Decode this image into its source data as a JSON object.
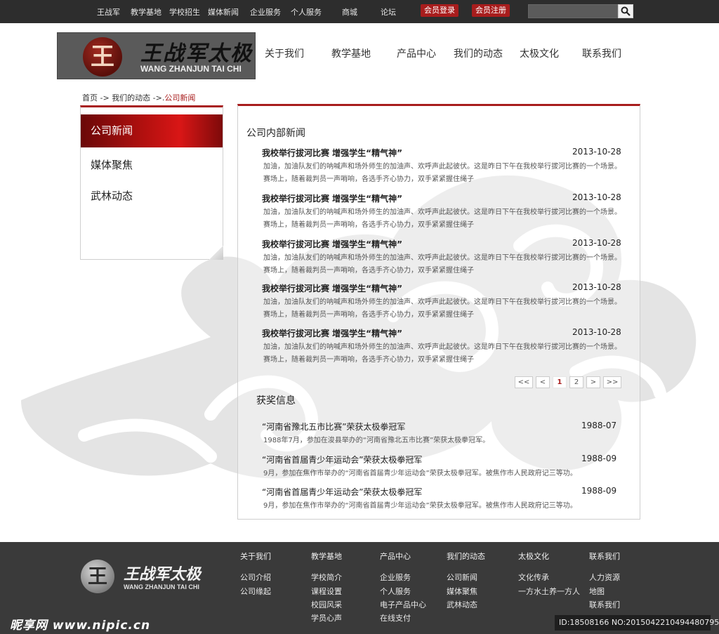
{
  "topbar": {
    "links": [
      "王战军",
      "教学基地",
      "学校招生",
      "媒体新闻",
      "企业服务",
      "个人服务",
      "商城",
      "论坛"
    ],
    "login_label": "会员登录",
    "register_label": "会员注册",
    "search_placeholder": ""
  },
  "header": {
    "logo_seal": "王",
    "logo_cn": "王战军太极",
    "logo_en": "WANG ZHANJUN TAI CHI",
    "nav": [
      "关于我们",
      "教学基地",
      "产品中心",
      "我们的动态",
      "太极文化",
      "联系我们"
    ]
  },
  "breadcrumb": {
    "home": "首页",
    "sep1": " -> ",
    "middle": "我们的动态",
    "sep2": " ->.",
    "current": "公司新闻"
  },
  "sidebar": {
    "items": [
      "公司新闻",
      "媒体聚焦",
      "武林动态"
    ]
  },
  "news": {
    "section_title": "公司内部新闻",
    "items": [
      {
        "title": "我校举行拔河比赛 增强学生“精气神”",
        "date": "2013-10-28",
        "summary": "加油，加油队友们的呐喊声和场外师生的加油声、欢呼声此起彼伏。这是昨日下午在我校举行拔河比赛的一个场景。赛场上，随着裁判员一声哨响，各选手齐心协力，双手紧紧握住绳子"
      },
      {
        "title": "我校举行拔河比赛 增强学生“精气神”",
        "date": "2013-10-28",
        "summary": "加油，加油队友们的呐喊声和场外师生的加油声、欢呼声此起彼伏。这是昨日下午在我校举行拔河比赛的一个场景。赛场上，随着裁判员一声哨响，各选手齐心协力，双手紧紧握住绳子"
      },
      {
        "title": "我校举行拔河比赛 增强学生“精气神”",
        "date": "2013-10-28",
        "summary": "加油，加油队友们的呐喊声和场外师生的加油声、欢呼声此起彼伏。这是昨日下午在我校举行拔河比赛的一个场景。赛场上，随着裁判员一声哨响，各选手齐心协力，双手紧紧握住绳子"
      },
      {
        "title": "我校举行拔河比赛 增强学生“精气神”",
        "date": "2013-10-28",
        "summary": "加油，加油队友们的呐喊声和场外师生的加油声、欢呼声此起彼伏。这是昨日下午在我校举行拔河比赛的一个场景。赛场上，随着裁判员一声哨响，各选手齐心协力，双手紧紧握住绳子"
      },
      {
        "title": "我校举行拔河比赛 增强学生“精气神”",
        "date": "2013-10-28",
        "summary": "加油，加油队友们的呐喊声和场外师生的加油声、欢呼声此起彼伏。这是昨日下午在我校举行拔河比赛的一个场景。赛场上，随着裁判员一声哨响，各选手齐心协力，双手紧紧握住绳子"
      }
    ]
  },
  "pagination": {
    "first": "<<",
    "prev": "<",
    "pages": [
      "1",
      "2"
    ],
    "current": "1",
    "next": ">",
    "last": ">>"
  },
  "awards": {
    "section_title": "获奖信息",
    "items": [
      {
        "title": "“河南省豫北五市比赛”荣获太极拳冠军",
        "date": "1988-07",
        "desc": "1988年7月，参加在浚县举办的“河南省豫北五市比赛”荣获太极拳冠军。"
      },
      {
        "title": "“河南省首届青少年运动会”荣获太极拳冠军",
        "date": "1988-09",
        "desc": "9月，参加在焦作市举办的“河南省首届青少年运动会”荣获太极拳冠军。被焦作市人民政府记三等功。"
      },
      {
        "title": "“河南省首届青少年运动会”荣获太极拳冠军",
        "date": "1988-09",
        "desc": "9月，参加在焦作市举办的“河南省首届青少年运动会”荣获太极拳冠军。被焦作市人民政府记三等功。"
      }
    ]
  },
  "footer": {
    "logo_seal": "王",
    "logo_cn": "王战军太极",
    "logo_en": "WANG ZHANJUN TAI CHI",
    "columns": [
      {
        "head": "关于我们",
        "links": [
          "公司介绍",
          "公司缘起"
        ]
      },
      {
        "head": "教学基地",
        "links": [
          "学校简介",
          "课程设置",
          "校园风采",
          "学员心声"
        ]
      },
      {
        "head": "产品中心",
        "links": [
          "企业服务",
          "个人服务",
          "电子产品中心",
          "在线支付"
        ]
      },
      {
        "head": "我们的动态",
        "links": [
          "公司新闻",
          "媒体聚焦",
          "武林动态"
        ]
      },
      {
        "head": "太极文化",
        "links": [
          "文化传承",
          "一方水土养一方人"
        ]
      },
      {
        "head": "联系我们",
        "links": [
          "人力资源",
          "地图",
          "联系我们"
        ]
      }
    ],
    "watermark_left": "昵享网 www.nipic.cn",
    "watermark_right": "ID:18508166 NO:20150422104944807950"
  },
  "colors": {
    "accent": "#a81d1d",
    "topbar": "#2d2d2d",
    "footer": "#3a3a3a"
  },
  "icons": {
    "search": "search-icon",
    "sidebar_corner": "page-curl-icon",
    "background": "auspicious-cloud-motif"
  }
}
